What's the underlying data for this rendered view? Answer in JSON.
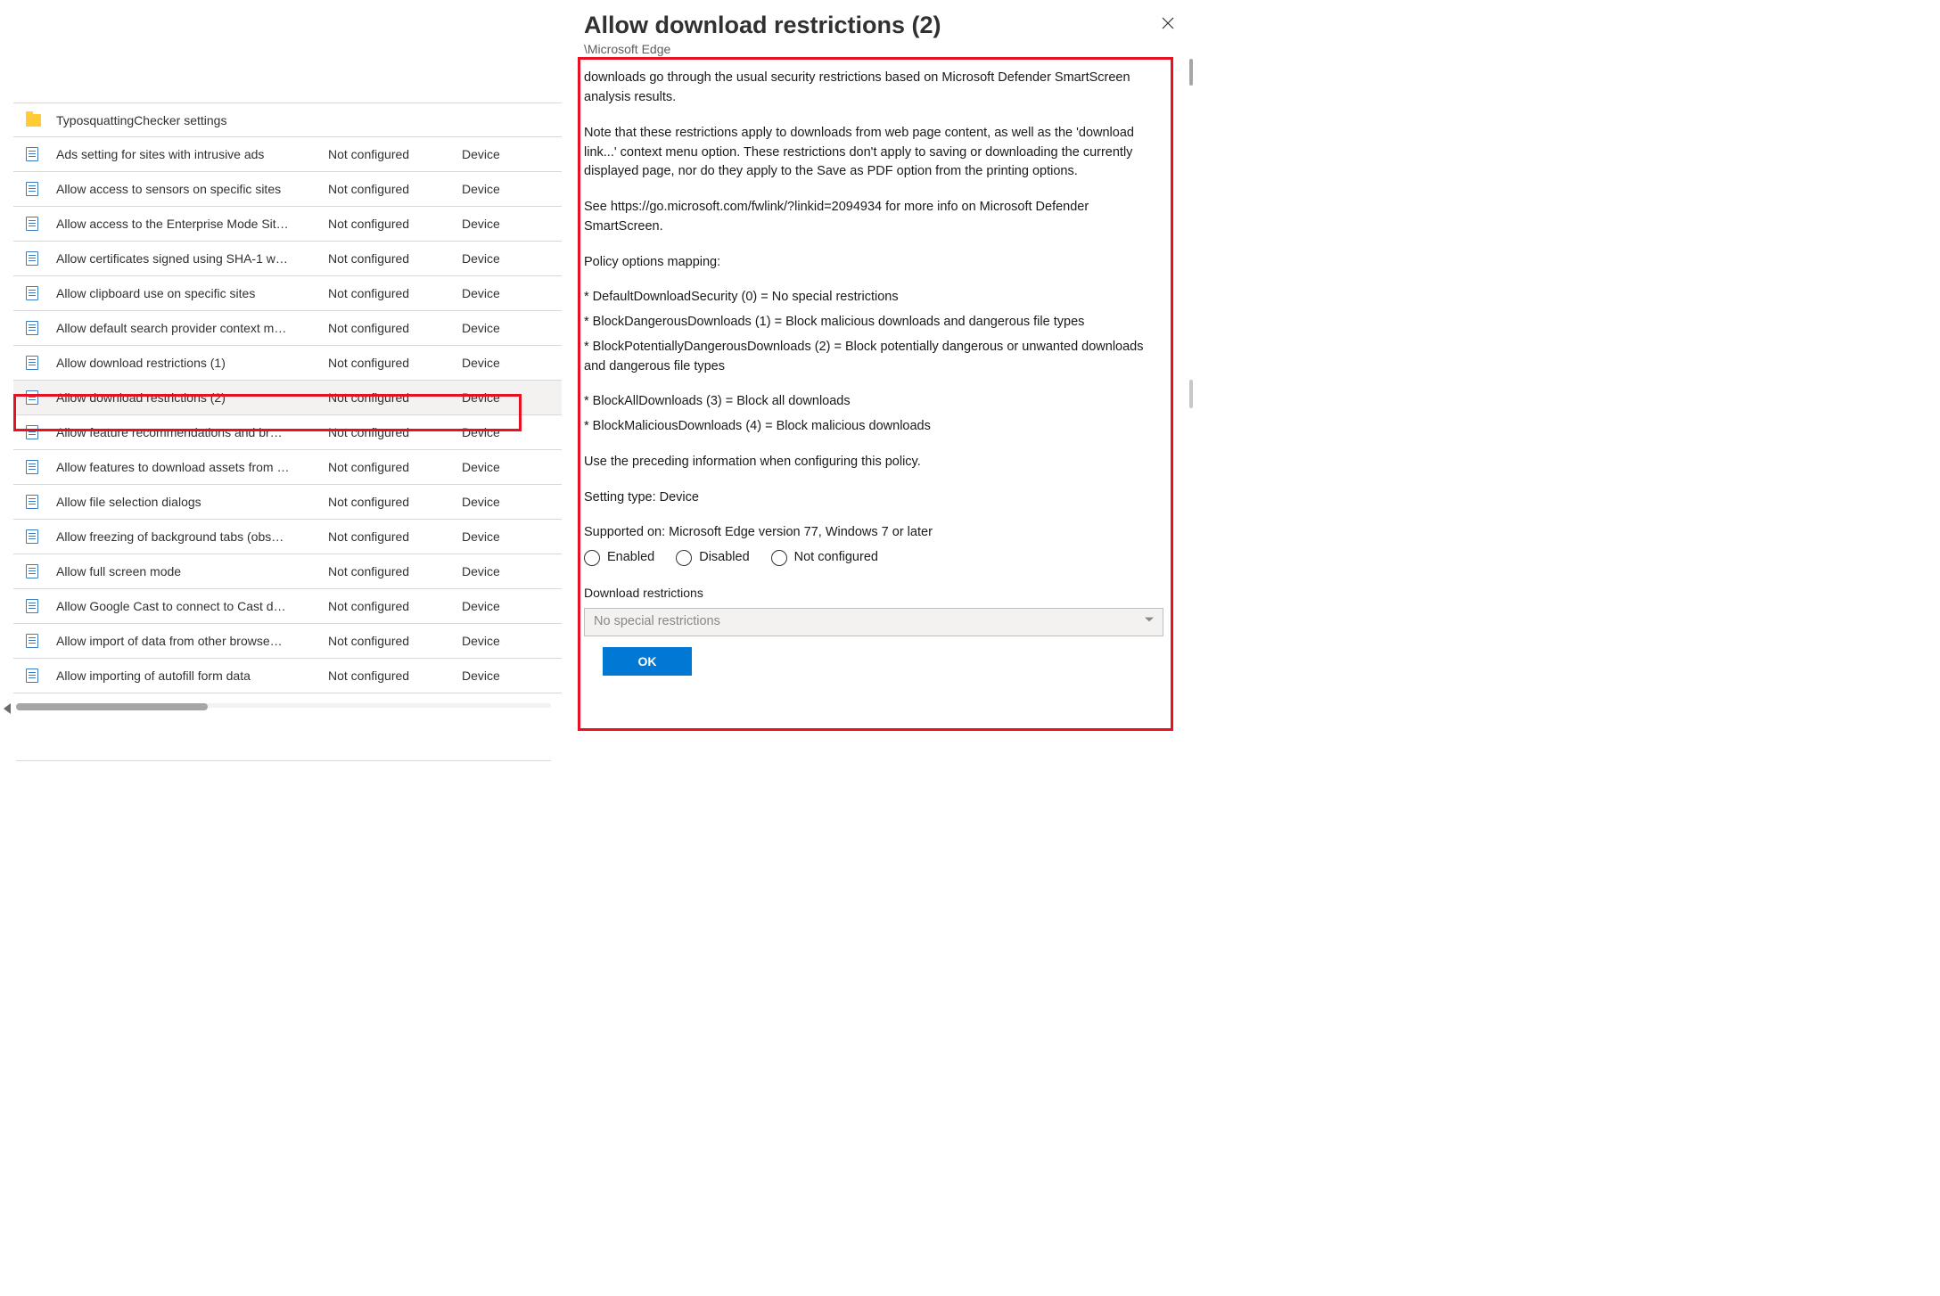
{
  "panel": {
    "title": "Allow download restrictions (2)",
    "breadcrumb": "\\Microsoft Edge",
    "description_paragraphs": [
      "downloads go through the usual security restrictions based on Microsoft Defender SmartScreen analysis results.",
      "Note that these restrictions apply to downloads from web page content, as well as the 'download link...' context menu option. These restrictions don't apply to saving or downloading the currently displayed page, nor do they apply to the Save as PDF option from the printing options.",
      "See https://go.microsoft.com/fwlink/?linkid=2094934 for more info on Microsoft Defender SmartScreen.",
      "Policy options mapping:",
      "* DefaultDownloadSecurity (0) = No special restrictions",
      "* BlockDangerousDownloads (1) = Block malicious downloads and dangerous file types",
      "* BlockPotentiallyDangerousDownloads (2) = Block potentially dangerous or unwanted downloads and dangerous file types",
      "* BlockAllDownloads (3) = Block all downloads",
      "* BlockMaliciousDownloads (4) = Block malicious downloads",
      "Use the preceding information when configuring this policy.",
      "Setting type: Device",
      "Supported on: Microsoft Edge version 77, Windows 7 or later"
    ],
    "radio_options": {
      "enabled": "Enabled",
      "disabled": "Disabled",
      "not_configured": "Not configured"
    },
    "dropdown_label": "Download restrictions",
    "dropdown_value": "No special restrictions",
    "ok_label": "OK"
  },
  "list": [
    {
      "type": "folder",
      "name": "TyposquattingChecker settings",
      "state": "",
      "scope": ""
    },
    {
      "type": "setting",
      "name": "Ads setting for sites with intrusive ads",
      "state": "Not configured",
      "scope": "Device"
    },
    {
      "type": "setting",
      "name": "Allow access to sensors on specific sites",
      "state": "Not configured",
      "scope": "Device"
    },
    {
      "type": "setting",
      "name": "Allow access to the Enterprise Mode Sit…",
      "state": "Not configured",
      "scope": "Device"
    },
    {
      "type": "setting",
      "name": "Allow certificates signed using SHA-1 w…",
      "state": "Not configured",
      "scope": "Device"
    },
    {
      "type": "setting",
      "name": "Allow clipboard use on specific sites",
      "state": "Not configured",
      "scope": "Device"
    },
    {
      "type": "setting",
      "name": "Allow default search provider context m…",
      "state": "Not configured",
      "scope": "Device"
    },
    {
      "type": "setting",
      "name": "Allow download restrictions (1)",
      "state": "Not configured",
      "scope": "Device"
    },
    {
      "type": "setting",
      "name": "Allow download restrictions (2)",
      "state": "Not configured",
      "scope": "Device",
      "selected": true
    },
    {
      "type": "setting",
      "name": "Allow feature recommendations and br…",
      "state": "Not configured",
      "scope": "Device"
    },
    {
      "type": "setting",
      "name": "Allow features to download assets from …",
      "state": "Not configured",
      "scope": "Device"
    },
    {
      "type": "setting",
      "name": "Allow file selection dialogs",
      "state": "Not configured",
      "scope": "Device"
    },
    {
      "type": "setting",
      "name": "Allow freezing of background tabs (obs…",
      "state": "Not configured",
      "scope": "Device"
    },
    {
      "type": "setting",
      "name": "Allow full screen mode",
      "state": "Not configured",
      "scope": "Device"
    },
    {
      "type": "setting",
      "name": "Allow Google Cast to connect to Cast d…",
      "state": "Not configured",
      "scope": "Device"
    },
    {
      "type": "setting",
      "name": "Allow import of data from other browse…",
      "state": "Not configured",
      "scope": "Device"
    },
    {
      "type": "setting",
      "name": "Allow importing of autofill form data",
      "state": "Not configured",
      "scope": "Device"
    }
  ]
}
